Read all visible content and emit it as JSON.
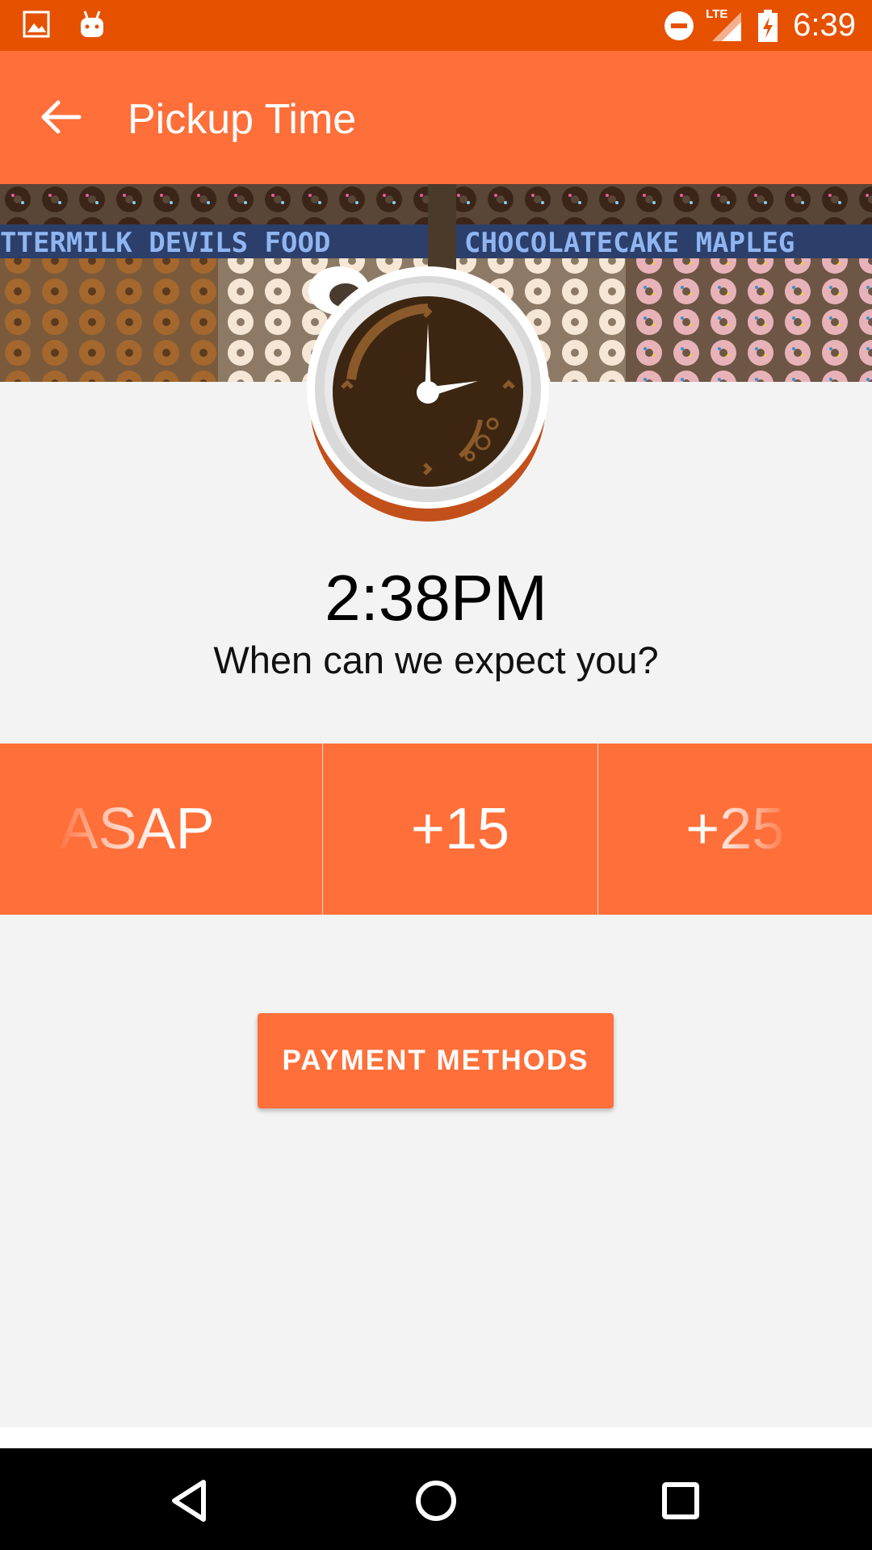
{
  "status_bar": {
    "time": "6:39",
    "network": "LTE",
    "icons": [
      "image-icon",
      "android-icon",
      "do-not-disturb-icon",
      "lte-signal-icon",
      "battery-charging-icon"
    ]
  },
  "app_bar": {
    "title": "Pickup Time",
    "back_icon": "arrow-back-icon",
    "background": "#ff6f3a"
  },
  "banner": {
    "signs": [
      "TTERMILK DEVILS FOOD",
      "CHOCOLATECAKE MAPLEG"
    ]
  },
  "pickup": {
    "time": "2:38PM",
    "question": "When can we expect you?",
    "options": [
      {
        "label": "ASAP"
      },
      {
        "label": "+15"
      },
      {
        "label": "+25"
      }
    ],
    "selected_label": "+15"
  },
  "payment_button": {
    "label": "PAYMENT METHODS"
  },
  "nav_bar": {
    "icons": [
      "nav-back-icon",
      "nav-home-icon",
      "nav-recents-icon"
    ]
  },
  "colors": {
    "status_bar": "#e65100",
    "accent": "#ff6f3a",
    "background": "#f4f3f4"
  }
}
